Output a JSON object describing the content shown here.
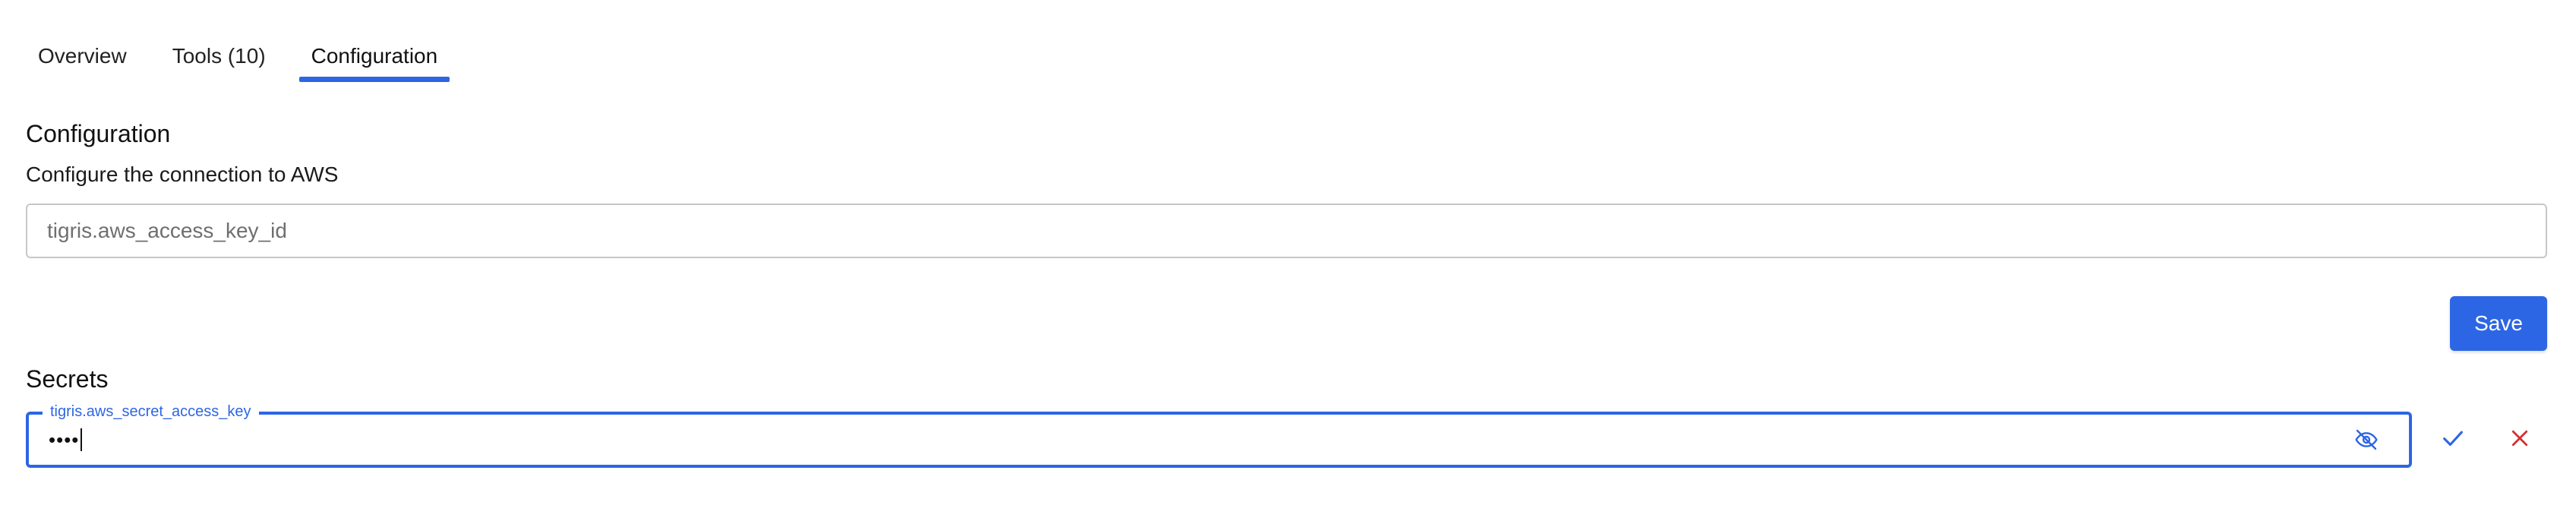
{
  "tabs": [
    {
      "label": "Overview",
      "active": false
    },
    {
      "label": "Tools (10)",
      "active": false
    },
    {
      "label": "Configuration",
      "active": true
    }
  ],
  "configuration": {
    "title": "Configuration",
    "description": "Configure the connection to AWS",
    "access_key_field": {
      "placeholder": "tigris.aws_access_key_id",
      "value": ""
    },
    "save_label": "Save"
  },
  "secrets": {
    "title": "Secrets",
    "secret_key_field": {
      "label": "tigris.aws_secret_access_key",
      "masked_value": "••••",
      "focused": true
    },
    "icons": {
      "visibility": "eye-off-icon",
      "confirm": "check-icon",
      "cancel": "close-icon"
    }
  },
  "colors": {
    "accent": "#2d66e4",
    "cancel": "#d32f2f",
    "border": "#c7c7c7"
  }
}
